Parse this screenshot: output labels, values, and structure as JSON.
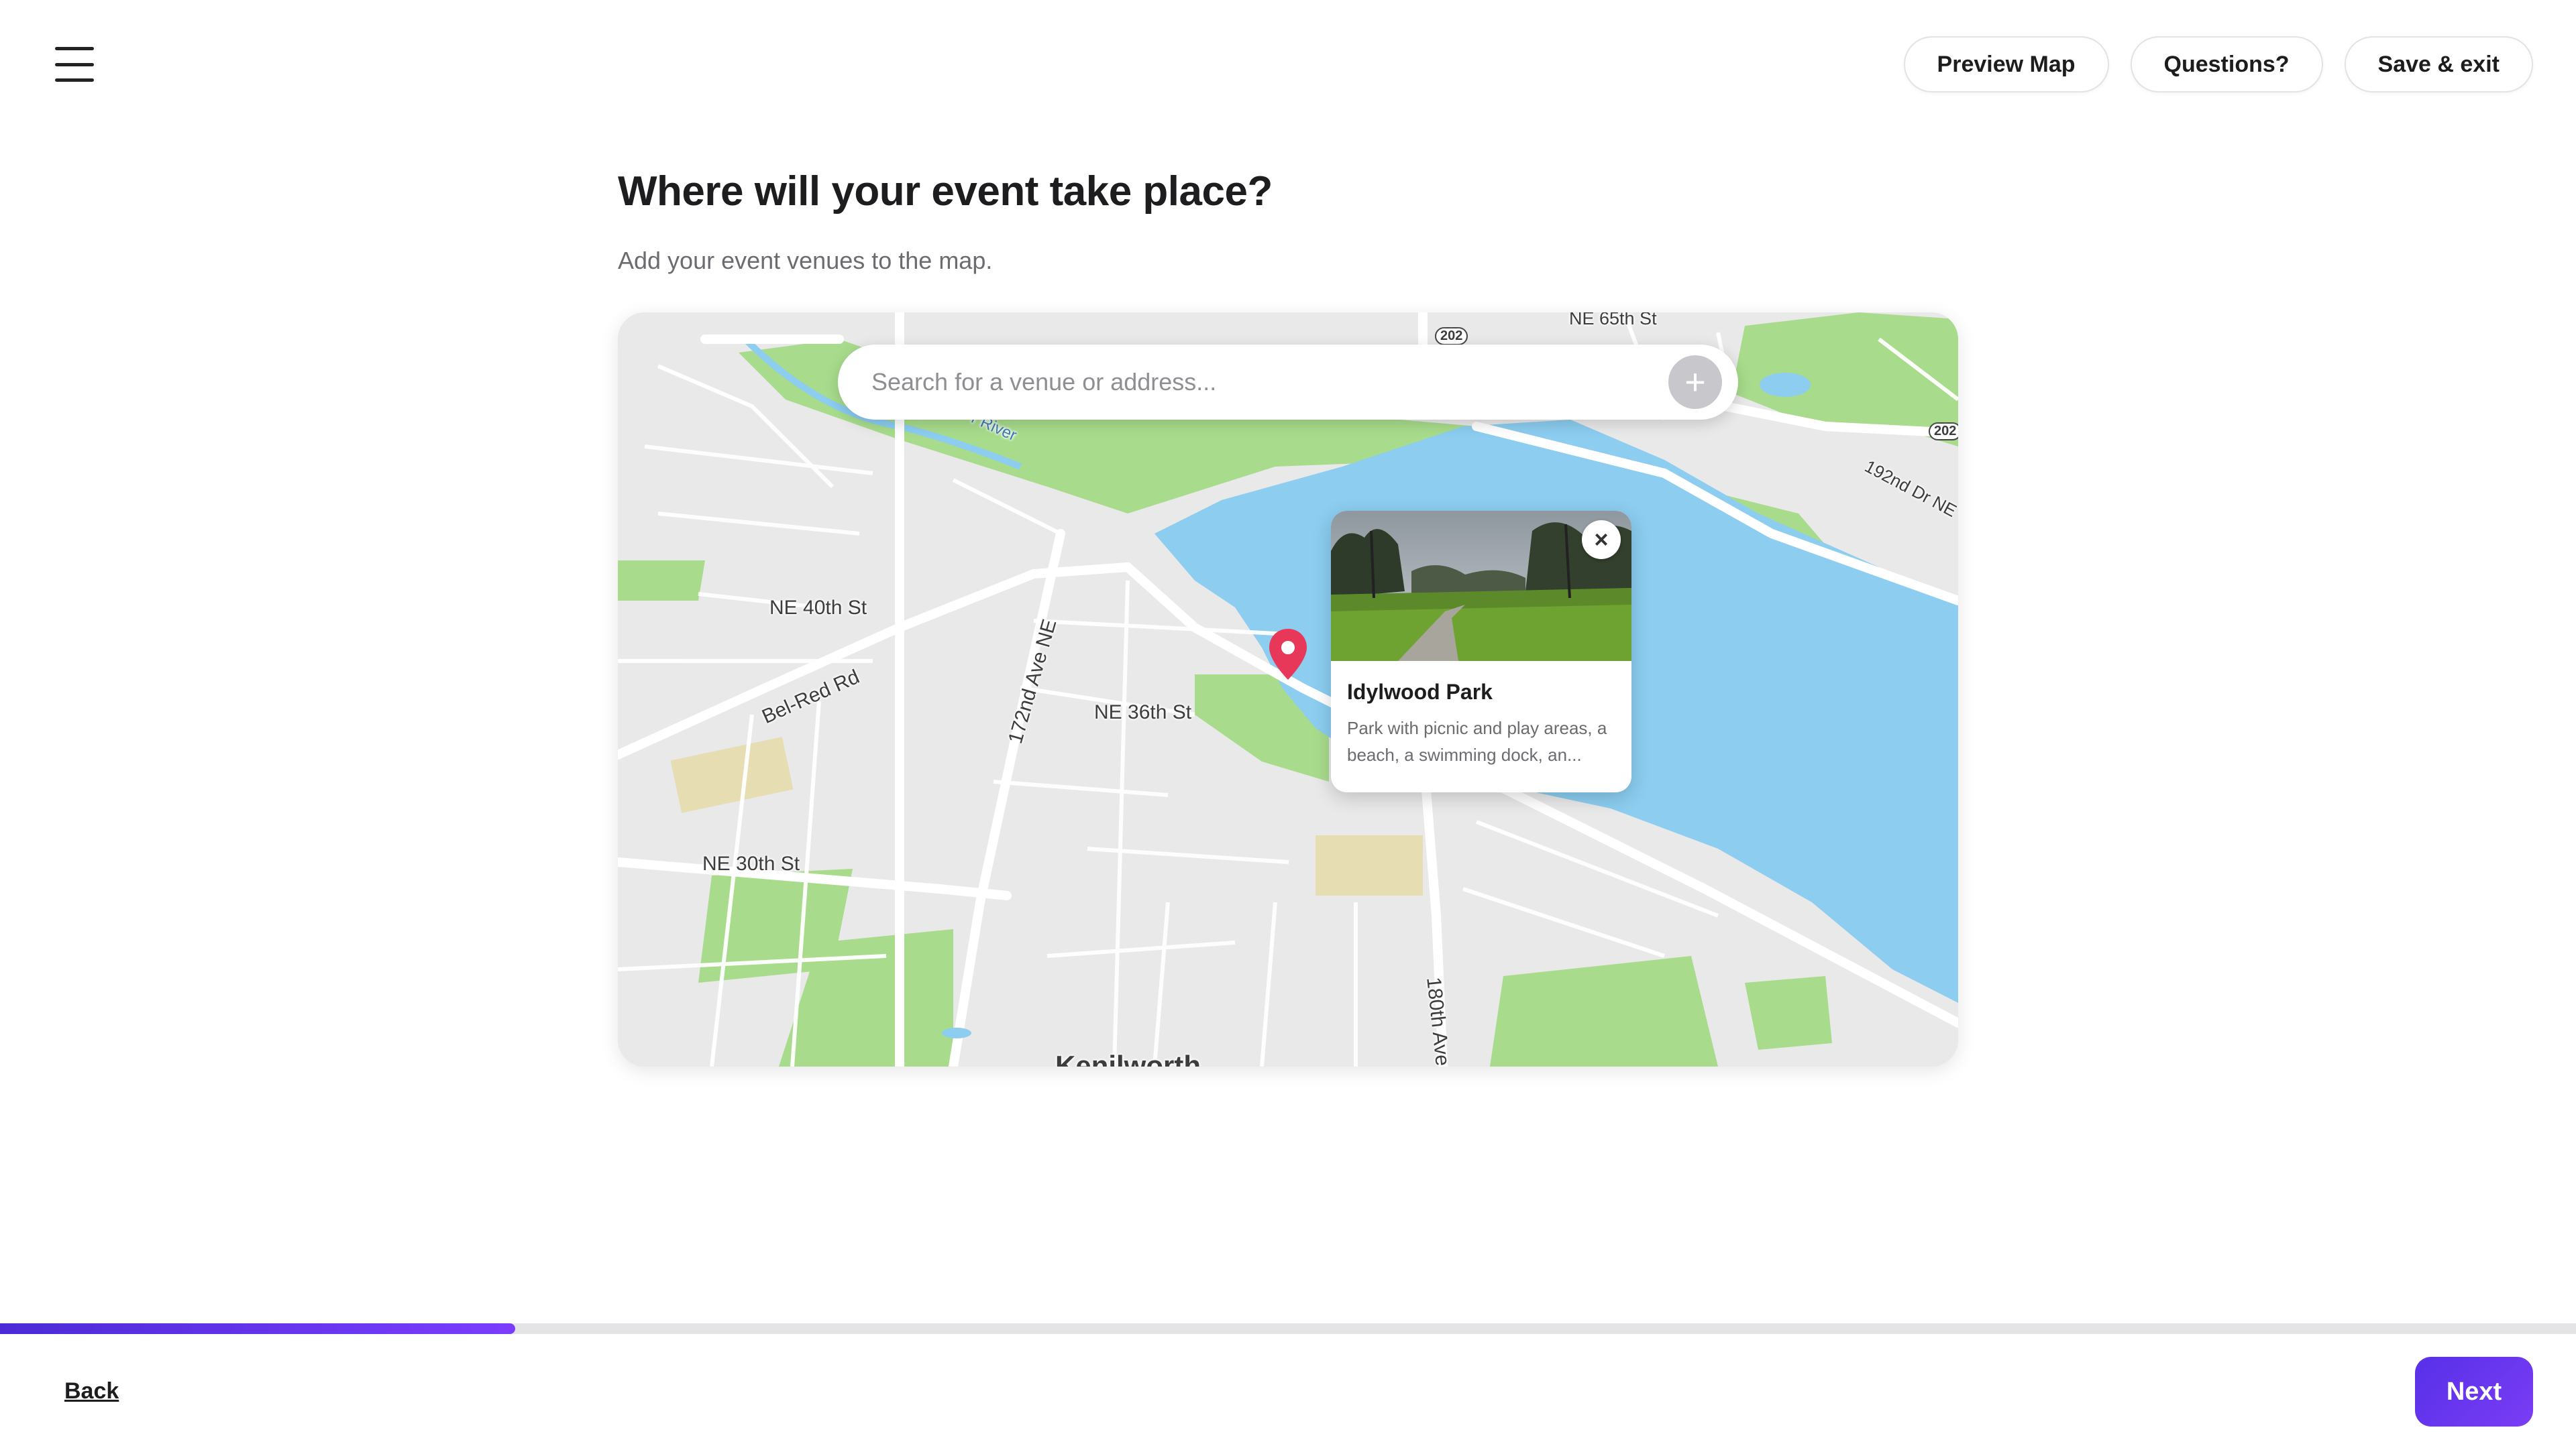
{
  "header": {
    "preview_label": "Preview Map",
    "questions_label": "Questions?",
    "save_exit_label": "Save & exit"
  },
  "main": {
    "title": "Where will your event take place?",
    "subtitle": "Add your event venues to the map."
  },
  "map": {
    "search_placeholder": "Search for a venue or address...",
    "add_symbol": "+",
    "street_labels": {
      "ne65": "NE 65th St",
      "ne40": "NE 40th St",
      "belred": "Bel-Red Rd",
      "ave172": "172nd Ave NE",
      "ne36": "NE 36th St",
      "ne30": "NE 30th St",
      "dr192": "192nd Dr NE",
      "ave180": "180th Ave",
      "river": "r River",
      "route202a": "202",
      "route202b": "202",
      "bottom_partial": "Kenilworth"
    },
    "venue": {
      "name": "Idylwood Park",
      "description": "Park with picnic and play areas, a beach, a swimming dock, an...",
      "close_symbol": "×"
    },
    "colors": {
      "water": "#8ccdf0",
      "park": "#a8dc8c",
      "land": "#e9e9e9",
      "pin": "#e8385a"
    }
  },
  "footer": {
    "back_label": "Back",
    "next_label": "Next",
    "progress": 0.2
  },
  "icons": {
    "menu": "hamburger-menu-icon",
    "add": "plus-icon",
    "close": "close-icon",
    "pin": "location-pin-icon"
  }
}
